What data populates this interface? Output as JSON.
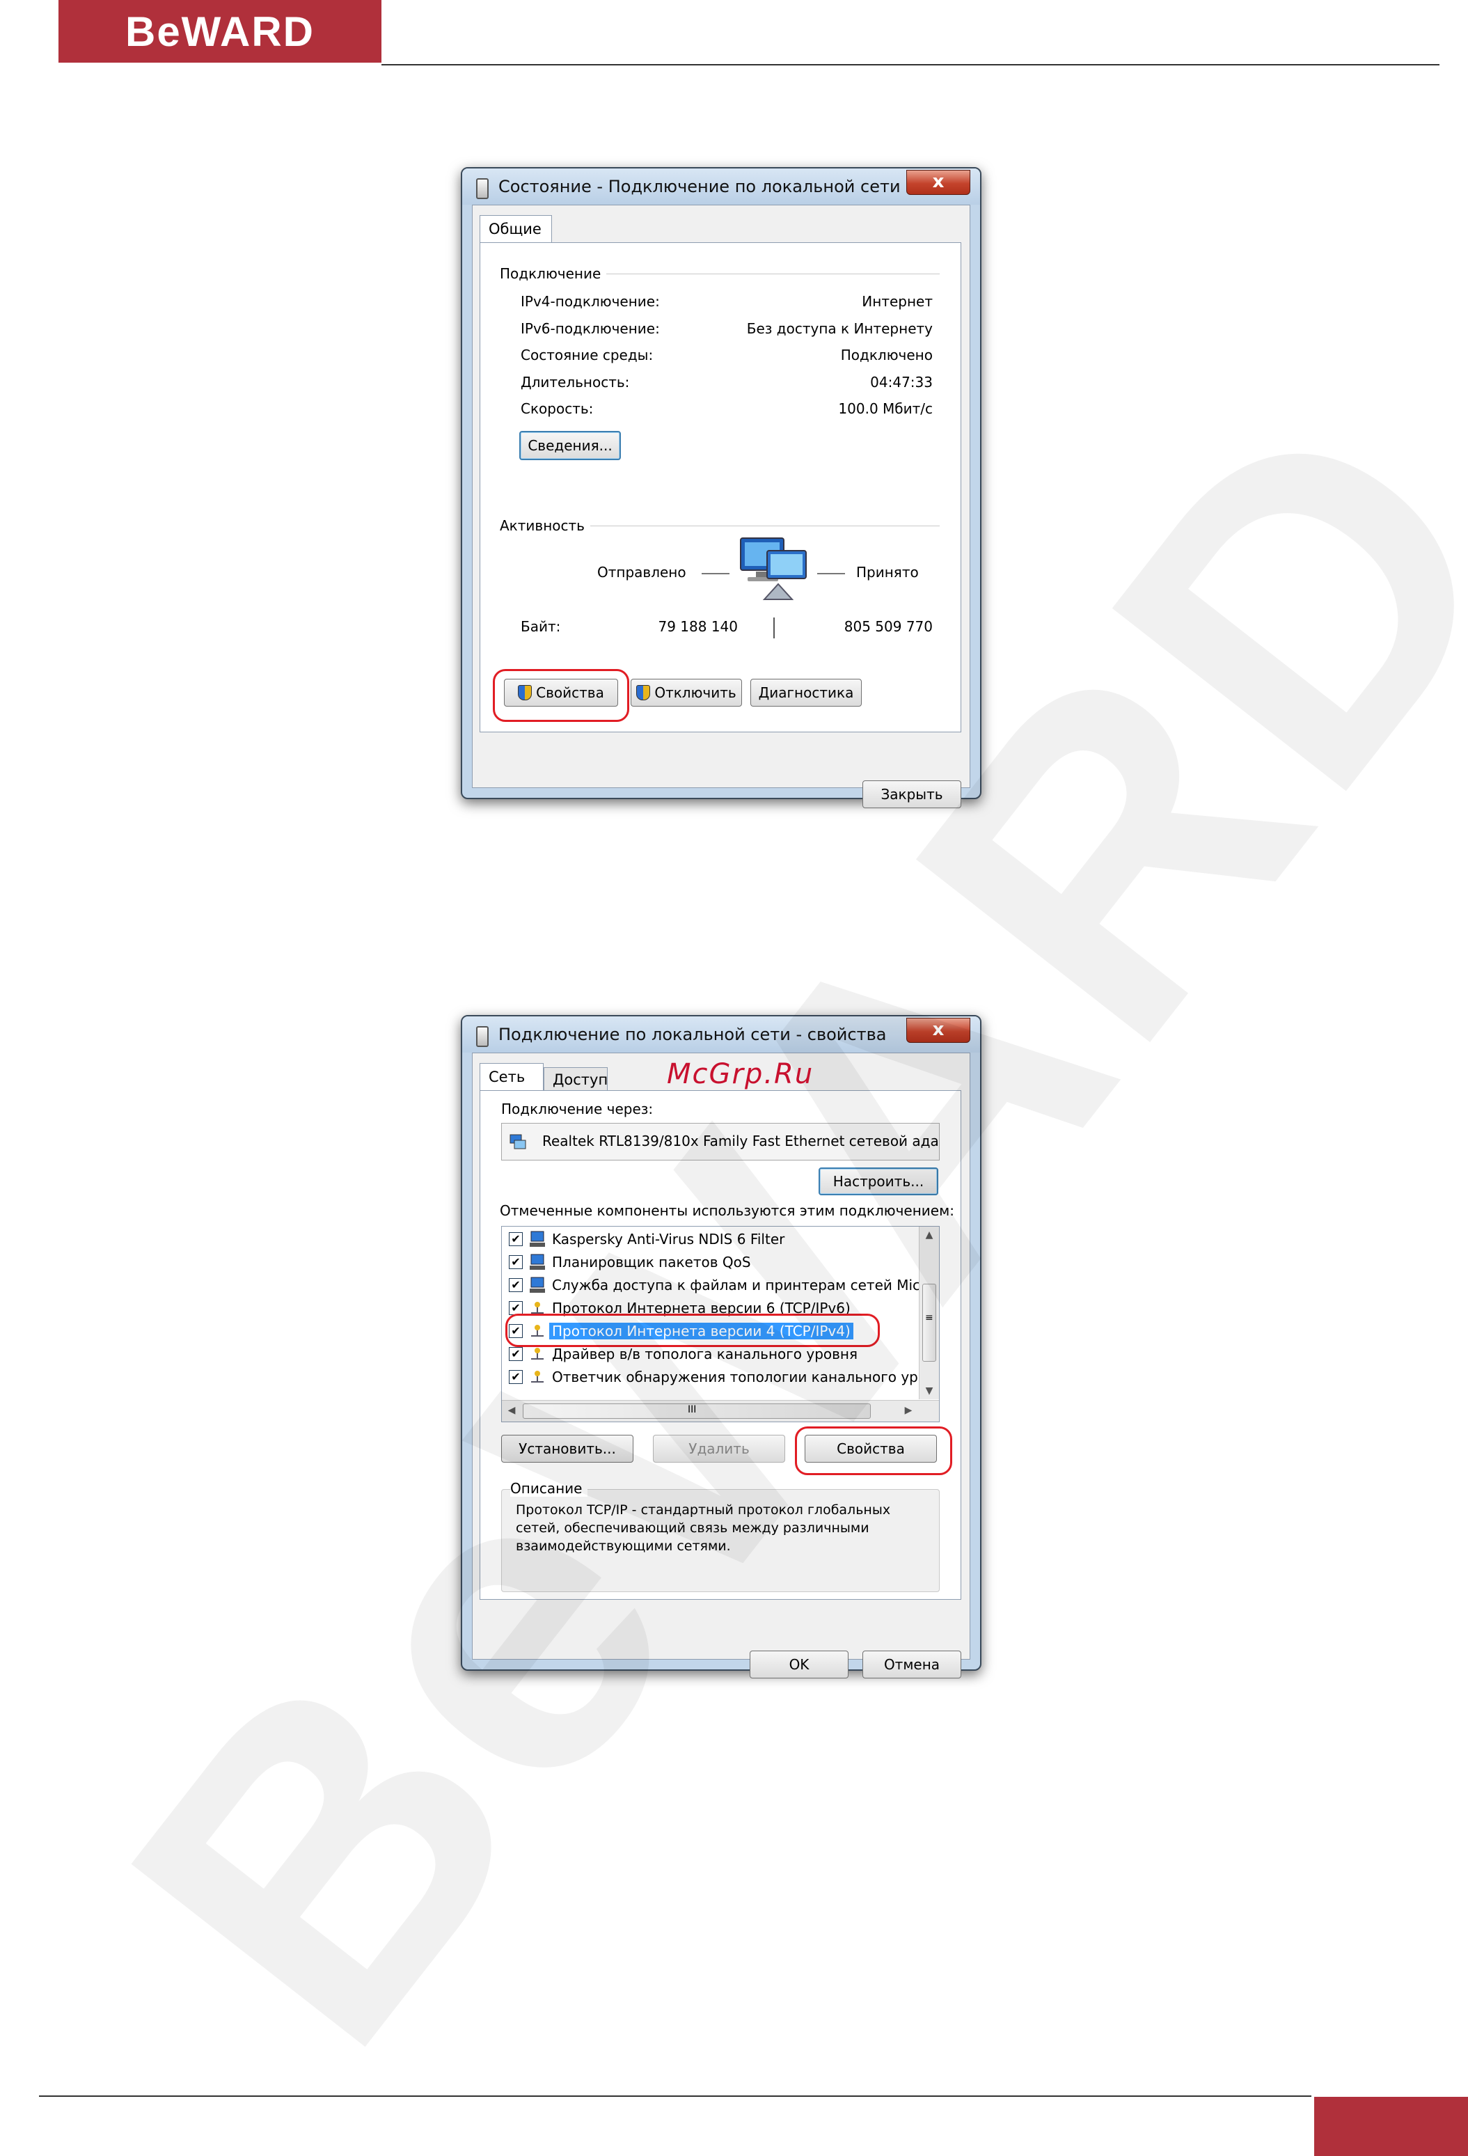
{
  "brand": {
    "logo_text": "BeWARD",
    "accent": "#b0303b"
  },
  "watermark": {
    "text": "BeWARD",
    "site_text": "McGrp.Ru"
  },
  "status_dialog": {
    "title": "Состояние - Подключение по локальной сети",
    "close_glyph": "x",
    "tab_general": "Общие",
    "connection_group": "Подключение",
    "rows": [
      {
        "label": "IPv4-подключение:",
        "value": "Интернет"
      },
      {
        "label": "IPv6-подключение:",
        "value": "Без доступа к Интернету"
      },
      {
        "label": "Состояние среды:",
        "value": "Подключено"
      },
      {
        "label": "Длительность:",
        "value": "04:47:33"
      },
      {
        "label": "Скорость:",
        "value": "100.0 Мбит/с"
      }
    ],
    "details_button": "Сведения...",
    "activity_group": "Активность",
    "sent_label": "Отправлено",
    "received_label": "Принято",
    "bytes_label": "Байт:",
    "bytes_sent": "79 188 140",
    "bytes_received": "805 509 770",
    "properties_button": "Свойства",
    "disable_button": "Отключить",
    "diagnose_button": "Диагностика",
    "close_button": "Закрыть"
  },
  "properties_dialog": {
    "title": "Подключение по локальной сети - свойства",
    "close_glyph": "x",
    "tab_network": "Сеть",
    "tab_access": "Доступ",
    "connect_using_label": "Подключение через:",
    "adapter_name": "Realtek RTL8139/810x Family Fast Ethernet сетевой ада",
    "configure_button": "Настроить...",
    "components_label": "Отмеченные компоненты используются этим подключением:",
    "components": [
      {
        "name": "Kaspersky Anti-Virus NDIS 6 Filter",
        "checked": "✔",
        "icon": "network-client-icon"
      },
      {
        "name": "Планировщик пакетов QoS",
        "checked": "✔",
        "icon": "network-client-icon"
      },
      {
        "name": "Служба доступа к файлам и принтерам сетей Micro",
        "checked": "✔",
        "icon": "network-client-icon"
      },
      {
        "name": "Протокол Интернета версии 6 (TCP/IPv6)",
        "checked": "✔",
        "icon": "protocol-icon"
      },
      {
        "name": "Протокол Интернета версии 4 (TCP/IPv4)",
        "checked": "✔",
        "icon": "protocol-icon"
      },
      {
        "name": "Драйвер в/в тополога канального уровня",
        "checked": "✔",
        "icon": "protocol-icon"
      },
      {
        "name": "Ответчик обнаружения топологии канального уров",
        "checked": "✔",
        "icon": "protocol-icon"
      }
    ],
    "selected_index": 4,
    "scroll_h_thumb_glyph": "III",
    "scroll_v_thumb_glyph": "≡",
    "install_button": "Установить...",
    "remove_button": "Удалить",
    "properties_button": "Свойства",
    "description_group": "Описание",
    "description_text": "Протокол TCP/IP - стандартный протокол глобальных\nсетей, обеспечивающий связь между различными\nвзаимодействующими сетями.",
    "ok_button": "OK",
    "cancel_button": "Отмена"
  },
  "colors": {
    "highlight_oval": "#e11d24",
    "selection": "#3399ff",
    "watermark_site": "#c8102e"
  }
}
